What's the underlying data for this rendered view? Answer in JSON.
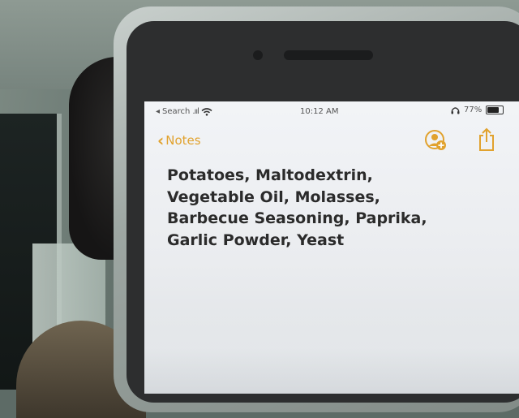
{
  "status_bar": {
    "back_app": "Search",
    "time": "10:12 AM",
    "battery_percent": "77%",
    "battery_level": 0.77
  },
  "nav": {
    "back_label": "Notes",
    "accent_color": "#e1a22e",
    "icons": [
      "chevron-left-icon",
      "collaborate-icon",
      "share-icon"
    ]
  },
  "note": {
    "lines": [
      "Potatoes, Maltodextrin,",
      "Vegetable Oil, Molasses,",
      "Barbecue Seasoning, Paprika,",
      "Garlic Powder, Yeast"
    ]
  }
}
